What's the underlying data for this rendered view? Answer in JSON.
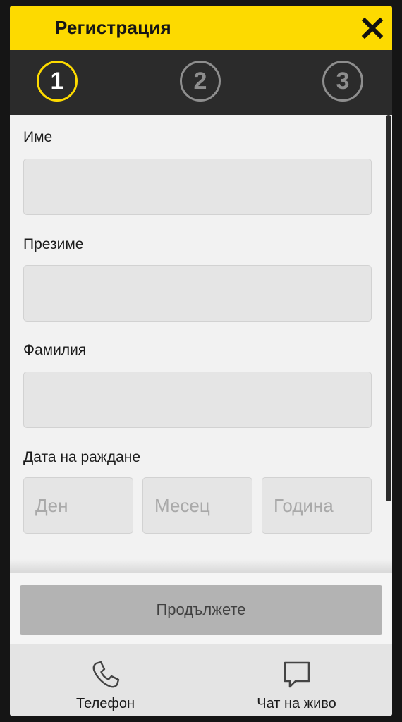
{
  "header": {
    "title": "Регистрация"
  },
  "steps": [
    "1",
    "2",
    "3"
  ],
  "form": {
    "first_name_label": "Име",
    "middle_name_label": "Презиме",
    "last_name_label": "Фамилия",
    "birthdate_label": "Дата на раждане",
    "day_placeholder": "Ден",
    "month_placeholder": "Месец",
    "year_placeholder": "Година"
  },
  "footer": {
    "continue_label": "Продължете",
    "phone_label": "Телефон",
    "chat_label": "Чат на живо"
  },
  "colors": {
    "accent": "#fdda00",
    "step_bar": "#2b2b2b",
    "button_disabled": "#b3b3b3"
  },
  "icons": {
    "close": "close-icon",
    "phone": "phone-icon",
    "chat": "chat-bubble-icon"
  }
}
